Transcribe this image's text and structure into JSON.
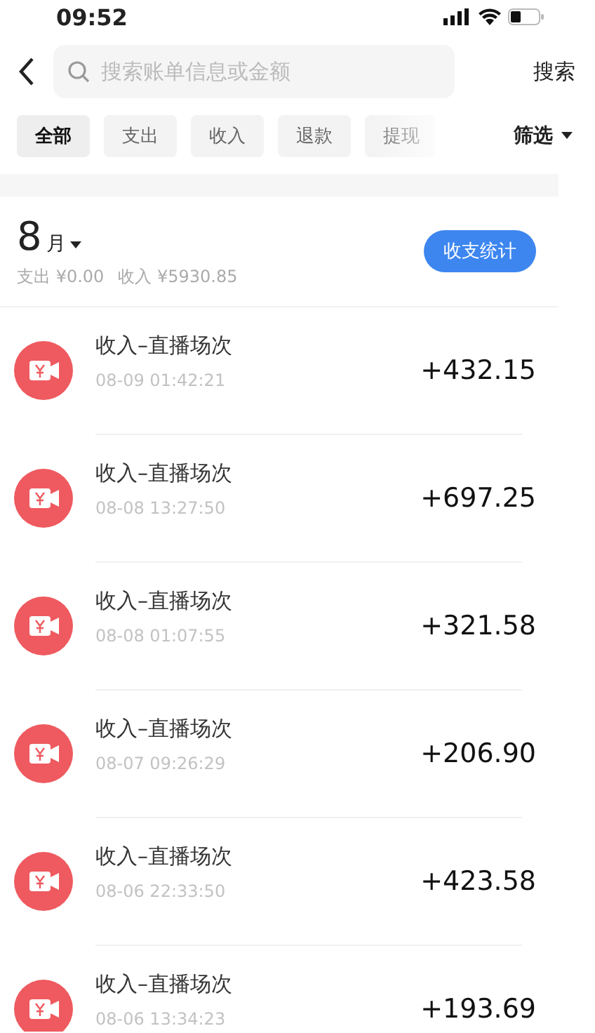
{
  "status_bar": {
    "time": "09:52"
  },
  "search": {
    "placeholder": "搜索账单信息或金额",
    "button": "搜索"
  },
  "filters": [
    {
      "label": "全部",
      "selected": true
    },
    {
      "label": "支出",
      "selected": false
    },
    {
      "label": "收入",
      "selected": false
    },
    {
      "label": "退款",
      "selected": false
    },
    {
      "label": "提现",
      "selected": false
    }
  ],
  "filter_menu": "筛选",
  "summary": {
    "month": "8",
    "month_unit": "月",
    "expense": "支出 ¥0.00",
    "income": "收入 ¥5930.85",
    "stats_button": "收支统计"
  },
  "transactions": [
    {
      "title": "收入–直播场次",
      "time": "08-09 01:42:21",
      "amount": "+432.15"
    },
    {
      "title": "收入–直播场次",
      "time": "08-08 13:27:50",
      "amount": "+697.25"
    },
    {
      "title": "收入–直播场次",
      "time": "08-08 01:07:55",
      "amount": "+321.58"
    },
    {
      "title": "收入–直播场次",
      "time": "08-07 09:26:29",
      "amount": "+206.90"
    },
    {
      "title": "收入–直播场次",
      "time": "08-06 22:33:50",
      "amount": "+423.58"
    },
    {
      "title": "收入–直播场次",
      "time": "08-06 13:34:23",
      "amount": "+193.69"
    }
  ]
}
